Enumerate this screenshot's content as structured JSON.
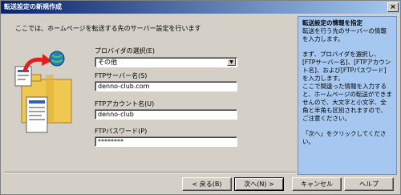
{
  "window": {
    "title": "転送設定の新規作成",
    "close_glyph": "×"
  },
  "intro": "ここでは、ホームページを転送する先のサーバー設定を行います",
  "form": {
    "provider_label": "プロバイダの選択(E)",
    "provider_value": "その他",
    "ftp_server_label": "FTPサーバー名(S)",
    "ftp_server_value": "denno-club.com",
    "ftp_account_label": "FTPアカウント名(U)",
    "ftp_account_value": "denno-club",
    "ftp_password_label": "FTPパスワード(P)",
    "ftp_password_value": "********"
  },
  "help": {
    "heading": "転送設定の情報を指定",
    "line1": "転送を行う先のサーバーの情報を入力します。",
    "line2": "まず、プロバイダを選択し、[FTPサーバー名]、[FTPアカウント名]、および[FTPパスワード]を入力します。",
    "line3": "ここで間違った情報を入力すると、ホームページの転送ができませんので、大文字と小文字、全角と半角も区別されますので、ご注意ください。",
    "line4": "「次へ」をクリックしてください。"
  },
  "buttons": {
    "back": "< 戻る(B)",
    "next": "次へ(N) >",
    "cancel": "キャンセル",
    "help": "ヘルプ"
  },
  "icons": {
    "globe": "globe-icon",
    "arrow": "curved-arrow-icon",
    "document": "document-icon",
    "folder": "folder-icon"
  }
}
